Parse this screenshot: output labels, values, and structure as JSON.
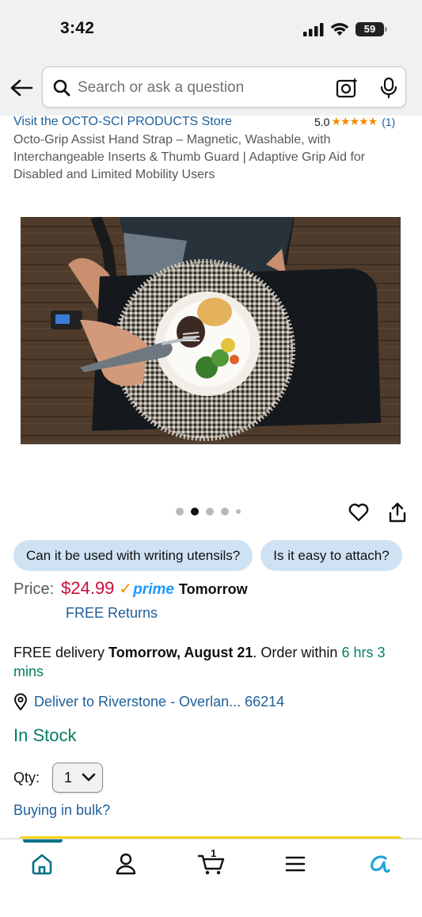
{
  "status_bar": {
    "time": "3:42",
    "battery": "59",
    "icons": [
      "signal-icon",
      "wifi-icon",
      "battery-icon"
    ]
  },
  "search": {
    "placeholder": "Search or ask a question",
    "icons": [
      "back-arrow-icon",
      "search-icon",
      "camera-icon",
      "mic-icon"
    ]
  },
  "product": {
    "store_link": "Visit the OCTO-SCI PRODUCTS Store",
    "rating_value": "5.0",
    "rating_stars": "★★★★★",
    "rating_count": "(1)",
    "title": "Octo-Grip Assist Hand Strap – Magnetic, Washable, with Interchangeable Inserts & Thumb Guard | Adaptive Grip Aid for Disabled and Limited Mobility Users",
    "image_count": 5,
    "active_image": 2
  },
  "questions": [
    {
      "label": "Can it be used with writing utensils?"
    },
    {
      "label": "Is it easy to attach?"
    }
  ],
  "price": {
    "label": "Price:",
    "value": "$24.99",
    "prime_check": "✓",
    "prime_word": "prime",
    "prime_day": "Tomorrow",
    "returns": "FREE Returns"
  },
  "delivery": {
    "prefix": "FREE delivery ",
    "date": "Tomorrow, August 21",
    "middle": ". Order within ",
    "timer": "6 hrs 3 mins",
    "deliver_to": "Deliver to Riverstone - Overlan... 66214"
  },
  "stock": {
    "status": "In Stock",
    "qty_label": "Qty:",
    "qty_value": "1",
    "bulk_link": "Buying in bulk?"
  },
  "nav": {
    "items": [
      "home-icon",
      "account-icon",
      "cart-icon",
      "menu-icon",
      "rufus-icon"
    ],
    "cart_count": "1"
  },
  "colors": {
    "link": "#1f5f99",
    "price": "#cc0c39",
    "in_stock": "#067d62",
    "prime": "#1a98ff",
    "star": "#f48a00",
    "chip": "#cfe2f3",
    "cta": "#ffd814"
  }
}
